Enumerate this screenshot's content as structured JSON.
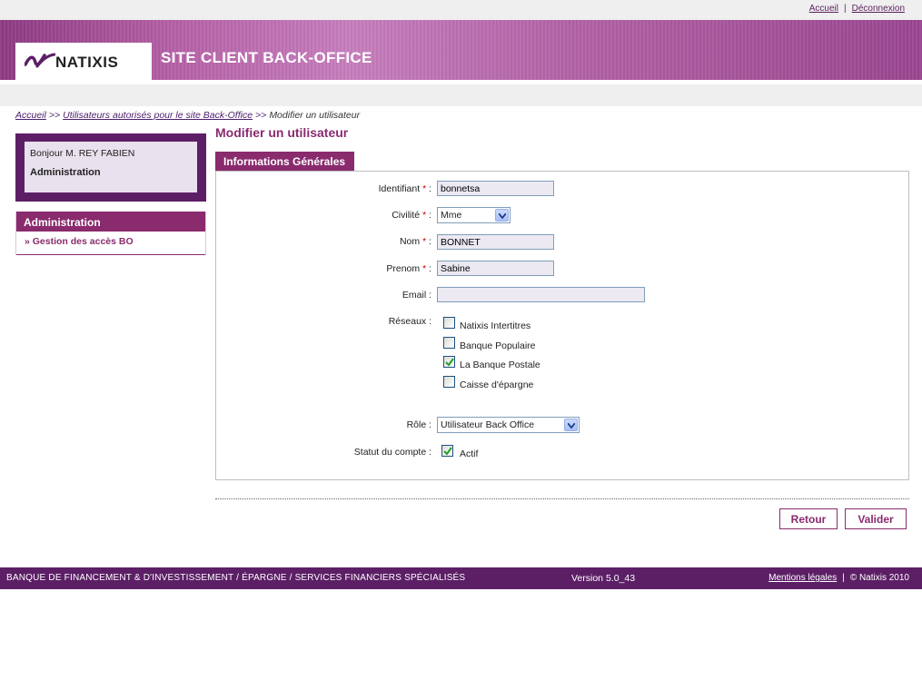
{
  "top": {
    "home_link": "Accueil",
    "separator": "|",
    "logout_link": "Déconnexion"
  },
  "banner": {
    "logo_text": "NATIXIS",
    "site_title": "SITE CLIENT BACK-OFFICE"
  },
  "breadcrumb": {
    "items": [
      "Accueil",
      "Utilisateurs autorisés pour le site Back-Office",
      "Modifier un utilisateur"
    ],
    "separator": ">>"
  },
  "sidebar": {
    "greeting": "Bonjour M. REY FABIEN",
    "role": "Administration",
    "menu_title": "Administration",
    "menu_item": "» Gestion des accès BO"
  },
  "main": {
    "title": "Modifier un utilisateur",
    "section_tab": "Informations Générales",
    "required_mark": "*",
    "fields": {
      "identifiant": {
        "label": "Identifiant",
        "value": "bonnetsa"
      },
      "civilite": {
        "label": "Civilité",
        "value": "Mme"
      },
      "nom": {
        "label": "Nom",
        "value": "BONNET"
      },
      "prenom": {
        "label": "Prenom",
        "value": "Sabine"
      },
      "email": {
        "label": "Email :",
        "value": ""
      },
      "reseaux": {
        "label": "Réseaux :",
        "options": [
          {
            "label": "Natixis Intertitres",
            "checked": false
          },
          {
            "label": "Banque Populaire",
            "checked": false
          },
          {
            "label": "La Banque Postale",
            "checked": true
          },
          {
            "label": "Caisse d'épargne",
            "checked": false
          }
        ]
      },
      "role": {
        "label": "Rôle :",
        "value": "Utilisateur Back Office"
      },
      "statut": {
        "label": "Statut du compte :",
        "option": "Actif",
        "checked": true
      }
    },
    "buttons": {
      "back": "Retour",
      "submit": "Valider"
    }
  },
  "footer": {
    "tagline": "BANQUE DE FINANCEMENT & D'INVESTISSEMENT / ÉPARGNE / SERVICES FINANCIERS SPÉCIALISÉS",
    "version": "Version 5.0_43",
    "legal_link": "Mentions légales",
    "separator": "|",
    "copyright": "© Natixis 2010"
  },
  "colors": {
    "brand": "#8a2b6e",
    "brand_dark": "#5c1f66",
    "required": "#cc0000"
  }
}
